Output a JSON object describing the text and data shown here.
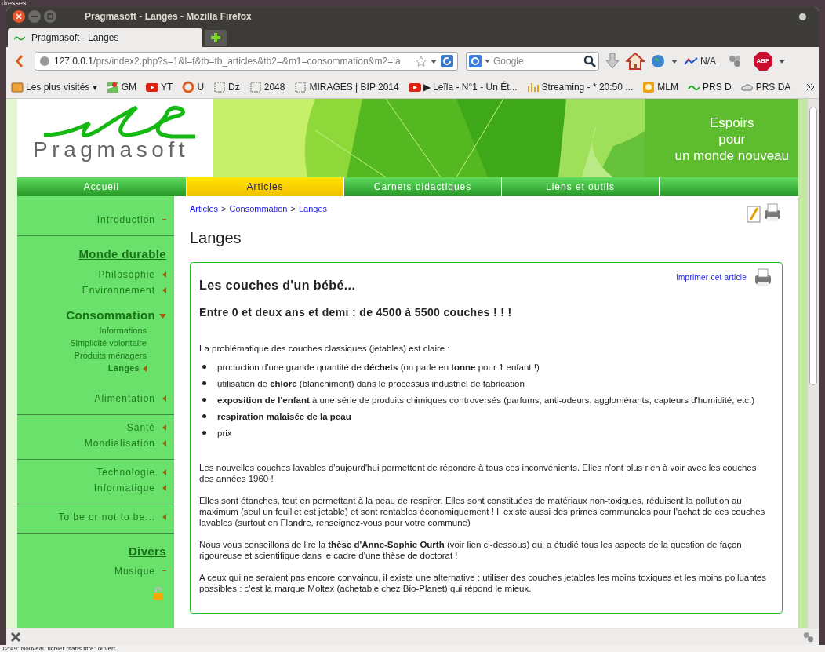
{
  "desktop": {
    "top_text": "dresses",
    "bottom_text": "12:49: Nouveau fichier \"sans titre\" ouvert."
  },
  "window": {
    "title": "Pragmasoft - Langes - Mozilla Firefox"
  },
  "tabs": [
    {
      "label": "Pragmasoft - Langes",
      "selected": true
    }
  ],
  "nav_bar": {
    "url_host": "127.0.0.1",
    "url_path": "/prs/index2.php?s=1&l=f&tb=tb_articles&tb2=&m1=consommation&m2=la",
    "search_placeholder": "Google",
    "addon_label": "N/A",
    "adblock_label": "ABP"
  },
  "bookmarks": [
    {
      "kind": "folder",
      "label": "Les plus visités ▾"
    },
    {
      "kind": "map",
      "label": "GM"
    },
    {
      "kind": "video",
      "label": "YT"
    },
    {
      "kind": "ring",
      "label": "U"
    },
    {
      "kind": "blank",
      "label": "Dz"
    },
    {
      "kind": "blank",
      "label": "2048"
    },
    {
      "kind": "blank",
      "label": "MIRAGES | BIP 2014"
    },
    {
      "kind": "video",
      "label": "▶ Leïla - N°1 - Un Ét..."
    },
    {
      "kind": "chart",
      "label": "Streaming - * 20:50 ..."
    },
    {
      "kind": "orange",
      "label": "MLM"
    },
    {
      "kind": "leaf",
      "label": "PRS D"
    },
    {
      "kind": "cloud",
      "label": "PRS DA"
    }
  ],
  "site": {
    "logo": "Pragmasoft",
    "tagline": [
      "Espoirs",
      "pour",
      "un monde nouveau"
    ]
  },
  "menu": [
    {
      "label": "Accueil",
      "selected": false
    },
    {
      "label": "Articles",
      "selected": true
    },
    {
      "label": "Carnets didactiques",
      "selected": false
    },
    {
      "label": "Liens et outils",
      "selected": false
    }
  ],
  "sidebar": [
    [
      {
        "kind": "page",
        "label": "Introduction"
      }
    ],
    [
      {
        "kind": "heading",
        "label": "Monde durable"
      },
      {
        "kind": "link",
        "label": "Philosophie"
      },
      {
        "kind": "link",
        "label": "Environnement"
      },
      {
        "kind": "section",
        "label": "Consommation",
        "expanded": true,
        "children": [
          {
            "label": "Informations",
            "selected": false
          },
          {
            "label": "Simplicité volontaire",
            "selected": false
          },
          {
            "label": "Produits ménagers",
            "selected": false
          },
          {
            "label": "Langes",
            "selected": true
          }
        ]
      },
      {
        "kind": "link",
        "label": "Alimentation"
      }
    ],
    [
      {
        "kind": "link",
        "label": "Santé"
      },
      {
        "kind": "link",
        "label": "Mondialisation"
      }
    ],
    [
      {
        "kind": "link",
        "label": "Technologie"
      },
      {
        "kind": "link",
        "label": "Informatique"
      }
    ],
    [
      {
        "kind": "link",
        "label": "To be or not to be..."
      }
    ],
    [
      {
        "kind": "heading",
        "label": "Divers"
      },
      {
        "kind": "page",
        "label": "Musique"
      }
    ]
  ],
  "breadcrumb": [
    "Articles",
    "Consommation",
    "Langes"
  ],
  "breadcrumb_separator": ">",
  "page_title": "Langes",
  "article": {
    "print_link": "imprimer cet article",
    "title": "Les couches d'un bébé...",
    "subtitle": "Entre 0 et deux ans et demi : de 4500 à 5500 couches ! ! !",
    "intro": "La problématique des couches classiques (jetables) est claire :",
    "bullets": [
      "production d'une grande quantité de **déchets** (on parle en **tonne** pour 1 enfant !)",
      "utilisation de **chlore** (blanchiment) dans le processus industriel de fabrication",
      "**exposition de l'enfant** à une série de produits chimiques controversés (parfums, anti-odeurs, agglomérants, capteurs d'humidité, etc.)",
      "**respiration malaisée de la peau**",
      "prix"
    ],
    "paragraphs": [
      "Les nouvelles couches lavables d'aujourd'hui permettent de répondre à tous ces inconvénients. Elles n'ont plus rien à voir avec les couches des années 1960 !",
      "Elles sont étanches, tout en permettant à la peau de respirer. Elles sont constituées de matériaux non-toxiques, réduisent la pollution au maximum (seul un feuillet est jetable) et sont rentables économiquement ! Il existe aussi des primes communales pour l'achat de ces couches lavables (surtout en Flandre, renseignez-vous pour votre commune)",
      "Nous vous conseillons de lire la **thèse d'Anne-Sophie Ourth** (voir lien ci-dessous) qui a étudié tous les aspects de la question de façon rigoureuse et scientifique dans le cadre d'une thèse de doctorat !",
      "A ceux qui ne seraient pas encore convaincu, il existe une alternative : utiliser des couches jetables les moins toxiques et les moins polluantes possibles : c'est la marque Moltex (achetable chez Bio-Planet) qui répond le mieux."
    ]
  }
}
